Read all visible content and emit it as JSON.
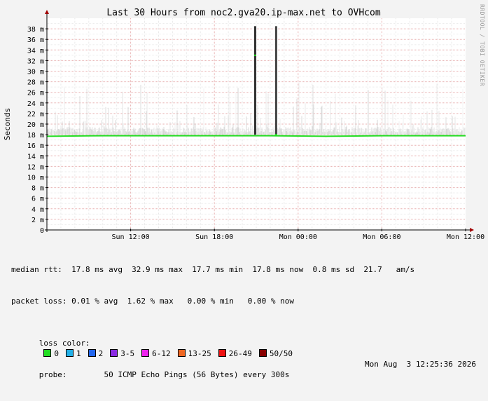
{
  "chart_data": {
    "type": "line",
    "title": "Last 30 Hours from noc2.gva20.ip-max.net to OVHcom",
    "ylabel": "Seconds",
    "watermark": "RRDTOOL / TOBI OETIKER",
    "ylim": [
      0,
      40
    ],
    "yticks": [
      0,
      2,
      4,
      6,
      8,
      10,
      12,
      14,
      16,
      18,
      20,
      22,
      24,
      26,
      28,
      30,
      32,
      34,
      36,
      38
    ],
    "ytick_labels": [
      "0",
      "2 m",
      "4 m",
      "6 m",
      "8 m",
      "10 m",
      "12 m",
      "14 m",
      "16 m",
      "18 m",
      "20 m",
      "22 m",
      "24 m",
      "26 m",
      "28 m",
      "30 m",
      "32 m",
      "34 m",
      "36 m",
      "38 m"
    ],
    "xlim_hours": [
      -30,
      0
    ],
    "xticks": [
      {
        "label": "Sun 12:00",
        "hour": -24
      },
      {
        "label": "Sun 18:00",
        "hour": -18
      },
      {
        "label": "Mon 00:00",
        "hour": -12
      },
      {
        "label": "Mon 06:00",
        "hour": -6
      },
      {
        "label": "Mon 12:00",
        "hour": 0
      }
    ],
    "series": [
      {
        "name": "median rtt",
        "color": "#22dd22",
        "x_hours": [
          -30,
          -26,
          -22,
          -18,
          -14,
          -10,
          -6,
          -2,
          0
        ],
        "values": [
          17.7,
          17.8,
          17.8,
          17.8,
          17.8,
          17.7,
          17.8,
          17.8,
          17.8
        ]
      }
    ],
    "spike_events": [
      {
        "hour": -15.1,
        "value": 38.5,
        "median": 33.0,
        "color": "#333333"
      },
      {
        "hour": -13.6,
        "value": 38.5,
        "median": 18.0,
        "color": "#444444"
      }
    ]
  },
  "stats": {
    "median_rtt": "median rtt:  17.8 ms avg  32.9 ms max  17.7 ms min  17.8 ms now  0.8 ms sd  21.7   am/s",
    "packet_loss": "packet loss: 0.01 % avg  1.62 % max   0.00 % min   0.00 % now",
    "loss_color_label": "loss color:",
    "probe": "probe:        50 ICMP Echo Pings (56 Bytes) every 300s",
    "timestamp": "Mon Aug  3 12:25:36 2026"
  },
  "loss_colors": [
    {
      "label": "0",
      "color": "#22dd22"
    },
    {
      "label": "1",
      "color": "#22b0e8"
    },
    {
      "label": "2",
      "color": "#2266ee"
    },
    {
      "label": "3-5",
      "color": "#8a2be2"
    },
    {
      "label": "6-12",
      "color": "#ee22ee"
    },
    {
      "label": "13-25",
      "color": "#ee6622"
    },
    {
      "label": "26-49",
      "color": "#ee1111"
    },
    {
      "label": "50/50",
      "color": "#880000"
    }
  ]
}
